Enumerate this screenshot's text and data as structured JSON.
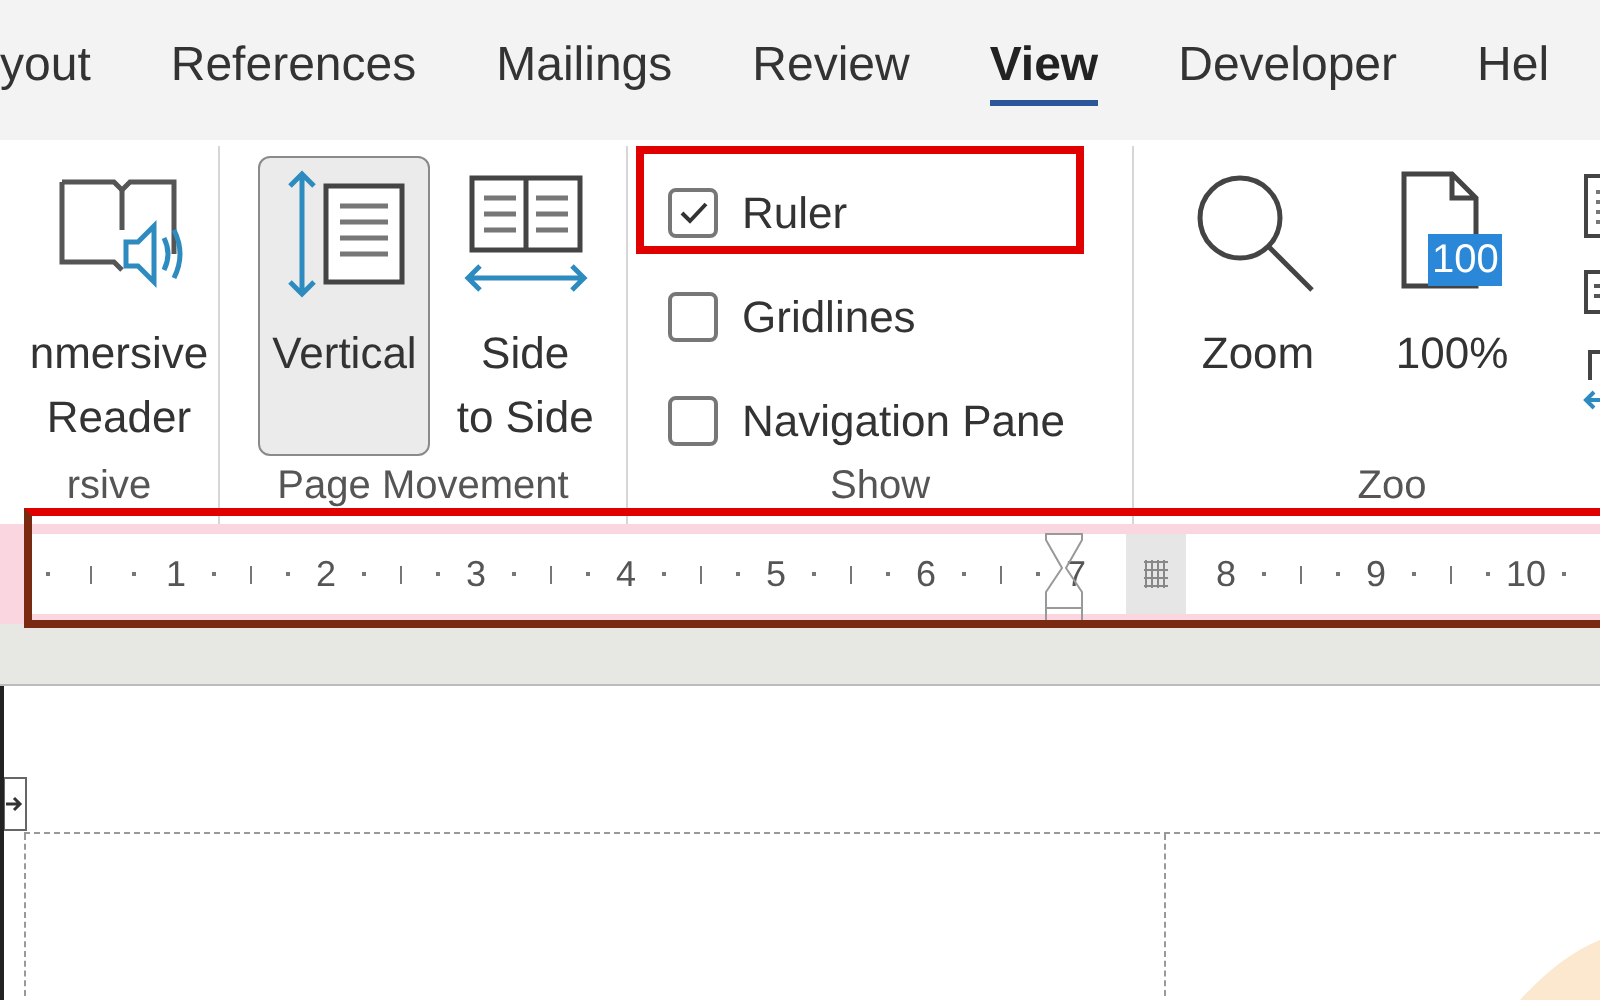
{
  "tabs": [
    {
      "label": "yout",
      "selected": false
    },
    {
      "label": "References",
      "selected": false
    },
    {
      "label": "Mailings",
      "selected": false
    },
    {
      "label": "Review",
      "selected": false
    },
    {
      "label": "View",
      "selected": true
    },
    {
      "label": "Developer",
      "selected": false
    },
    {
      "label": "Hel",
      "selected": false
    }
  ],
  "groups": [
    {
      "kind": "buttons",
      "label": "rsive",
      "buttons": [
        {
          "kind": "reader",
          "lines": [
            "nmersive",
            "Reader"
          ],
          "selected": false
        }
      ]
    },
    {
      "kind": "buttons",
      "label": "Page Movement",
      "buttons": [
        {
          "kind": "vertical",
          "lines": [
            "Vertical"
          ],
          "selected": true
        },
        {
          "kind": "side",
          "lines": [
            "Side",
            "to Side"
          ],
          "selected": false
        }
      ]
    },
    {
      "kind": "checks",
      "label": "Show",
      "options": [
        {
          "label": "Ruler",
          "checked": true
        },
        {
          "label": "Gridlines",
          "checked": false
        },
        {
          "label": "Navigation Pane",
          "checked": false
        }
      ]
    },
    {
      "kind": "zoom",
      "label": "Zoo",
      "buttons": [
        {
          "kind": "zoom",
          "lines": [
            "Zoom"
          ],
          "selected": false
        },
        {
          "kind": "percent",
          "lines": [
            "100%"
          ],
          "badge": "100",
          "selected": false
        }
      ]
    }
  ],
  "ruler": {
    "numbers": [
      {
        "label": "1",
        "kind": "plain"
      },
      {
        "label": "2",
        "kind": "plain"
      },
      {
        "label": "3",
        "kind": "plain"
      },
      {
        "label": "4",
        "kind": "plain"
      },
      {
        "label": "5",
        "kind": "plain"
      },
      {
        "label": "6",
        "kind": "plain"
      },
      {
        "label": "7",
        "kind": "margin"
      },
      {
        "label": "8",
        "kind": "plain"
      },
      {
        "label": "9",
        "kind": "plain"
      },
      {
        "label": "10",
        "kind": "plain"
      }
    ]
  }
}
